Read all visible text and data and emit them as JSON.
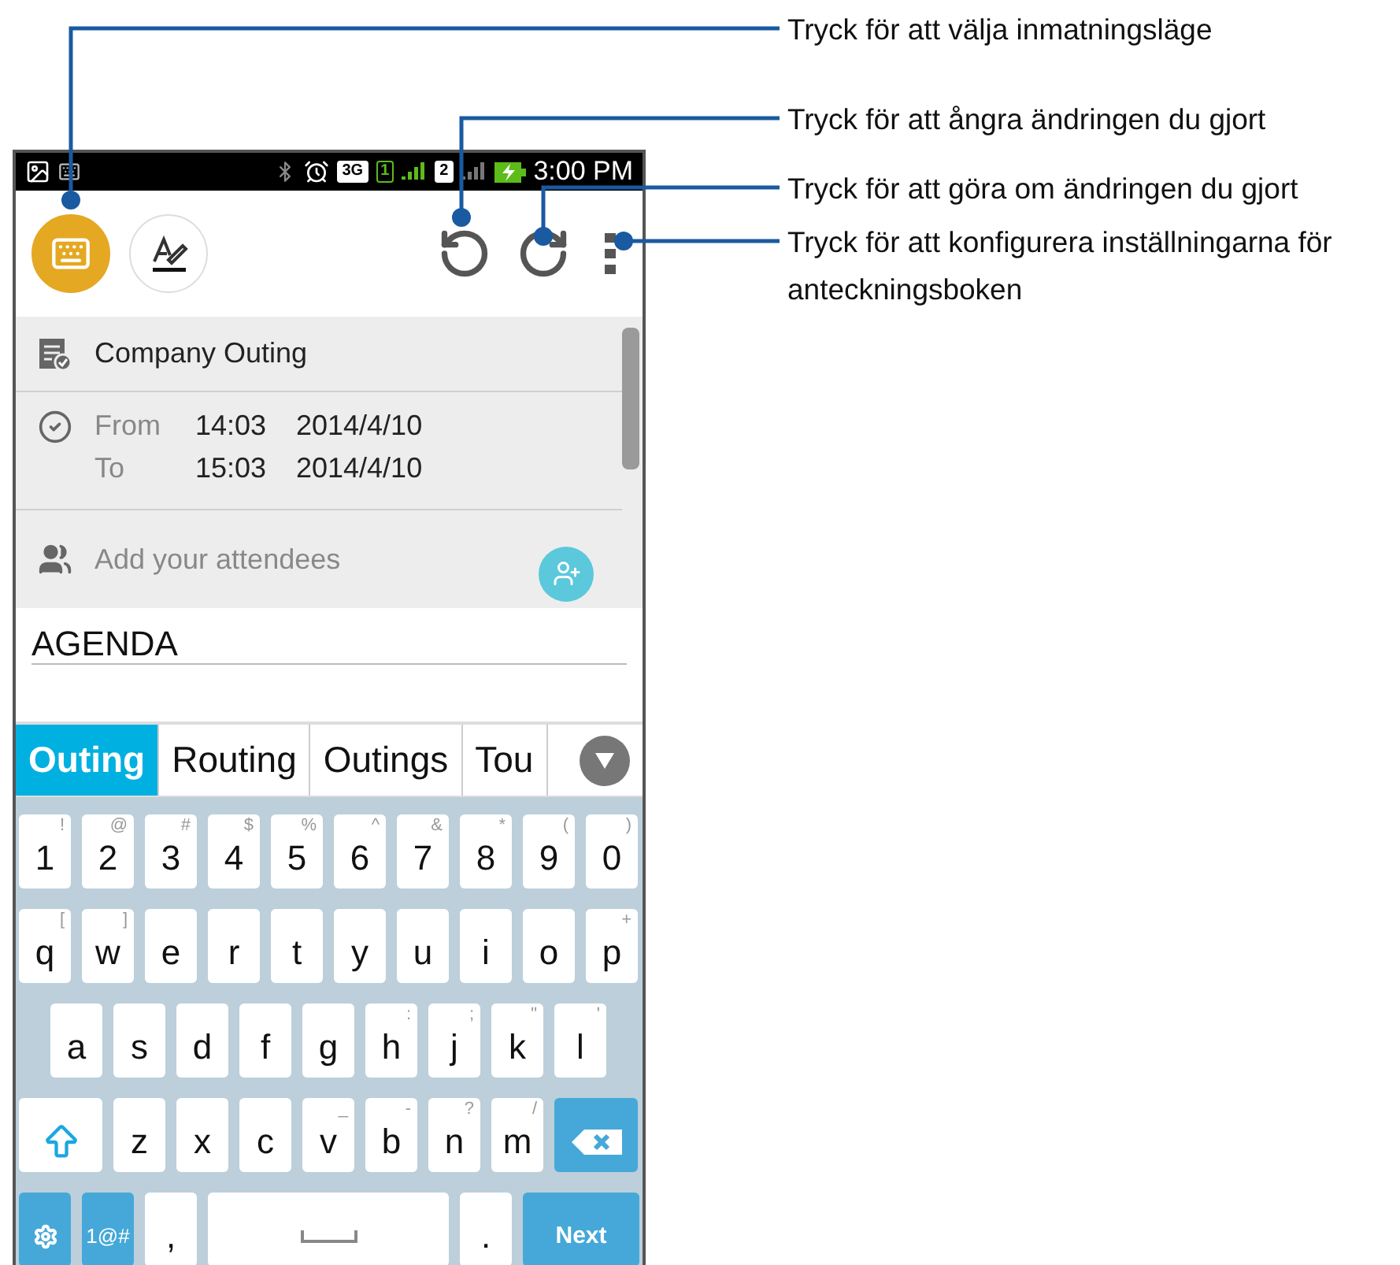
{
  "callouts": [
    {
      "text": "Tryck för att välja inmatningsläge"
    },
    {
      "text": "Tryck för att ångra ändringen du gjort"
    },
    {
      "text": "Tryck för att göra om ändringen du gjort"
    },
    {
      "text": "Tryck för att konfigurera inställningarna för anteckningsboken"
    }
  ],
  "status_bar": {
    "network": "3G",
    "sim1": "1",
    "sim2": "2",
    "time": "3:00 PM"
  },
  "toolbar": {
    "keyboard_mode": {
      "selected": true
    },
    "handwriting_mode": {
      "selected": false
    }
  },
  "event": {
    "title": "Company Outing",
    "times": [
      {
        "label": "From",
        "time": "14:03",
        "date": "2014/4/10"
      },
      {
        "label": "To",
        "time": "15:03",
        "date": "2014/4/10"
      }
    ],
    "attendees_placeholder": "Add your attendees"
  },
  "note": {
    "value": "AGENDA"
  },
  "suggestions": [
    {
      "text": "Outing",
      "selected": true
    },
    {
      "text": "Routing",
      "selected": false
    },
    {
      "text": "Outings",
      "selected": false
    },
    {
      "text": "Tou",
      "selected": false
    }
  ],
  "keyboard": {
    "rows": [
      [
        {
          "kind": "char",
          "label": "1",
          "hint": "!"
        },
        {
          "kind": "char",
          "label": "2",
          "hint": "@"
        },
        {
          "kind": "char",
          "label": "3",
          "hint": "#"
        },
        {
          "kind": "char",
          "label": "4",
          "hint": "$"
        },
        {
          "kind": "char",
          "label": "5",
          "hint": "%"
        },
        {
          "kind": "char",
          "label": "6",
          "hint": "^"
        },
        {
          "kind": "char",
          "label": "7",
          "hint": "&"
        },
        {
          "kind": "char",
          "label": "8",
          "hint": "*"
        },
        {
          "kind": "char",
          "label": "9",
          "hint": "("
        },
        {
          "kind": "char",
          "label": "0",
          "hint": ")"
        }
      ],
      [
        {
          "kind": "char",
          "label": "q",
          "hint": "["
        },
        {
          "kind": "char",
          "label": "w",
          "hint": "]"
        },
        {
          "kind": "char",
          "label": "e"
        },
        {
          "kind": "char",
          "label": "r"
        },
        {
          "kind": "char",
          "label": "t"
        },
        {
          "kind": "char",
          "label": "y"
        },
        {
          "kind": "char",
          "label": "u"
        },
        {
          "kind": "char",
          "label": "i"
        },
        {
          "kind": "char",
          "label": "o"
        },
        {
          "kind": "char",
          "label": "p",
          "hint": "+"
        }
      ],
      [
        {
          "kind": "char",
          "label": "a"
        },
        {
          "kind": "char",
          "label": "s"
        },
        {
          "kind": "char",
          "label": "d"
        },
        {
          "kind": "char",
          "label": "f"
        },
        {
          "kind": "char",
          "label": "g"
        },
        {
          "kind": "char",
          "label": "h",
          "hint": ":"
        },
        {
          "kind": "char",
          "label": "j",
          "hint": ";"
        },
        {
          "kind": "char",
          "label": "k",
          "hint": "\""
        },
        {
          "kind": "char",
          "label": "l",
          "hint": "'"
        }
      ],
      [
        {
          "kind": "shift"
        },
        {
          "kind": "char",
          "label": "z"
        },
        {
          "kind": "char",
          "label": "x"
        },
        {
          "kind": "char",
          "label": "c"
        },
        {
          "kind": "char",
          "label": "v",
          "hint": "_"
        },
        {
          "kind": "char",
          "label": "b",
          "hint": "-"
        },
        {
          "kind": "char",
          "label": "n",
          "hint": "?"
        },
        {
          "kind": "char",
          "label": "m",
          "hint": "/"
        },
        {
          "kind": "backspace"
        }
      ],
      [
        {
          "kind": "settings"
        },
        {
          "kind": "symbols",
          "label": "1@#"
        },
        {
          "kind": "char",
          "label": ","
        },
        {
          "kind": "space"
        },
        {
          "kind": "char",
          "label": "."
        },
        {
          "kind": "enter",
          "label": "Next"
        }
      ]
    ]
  }
}
